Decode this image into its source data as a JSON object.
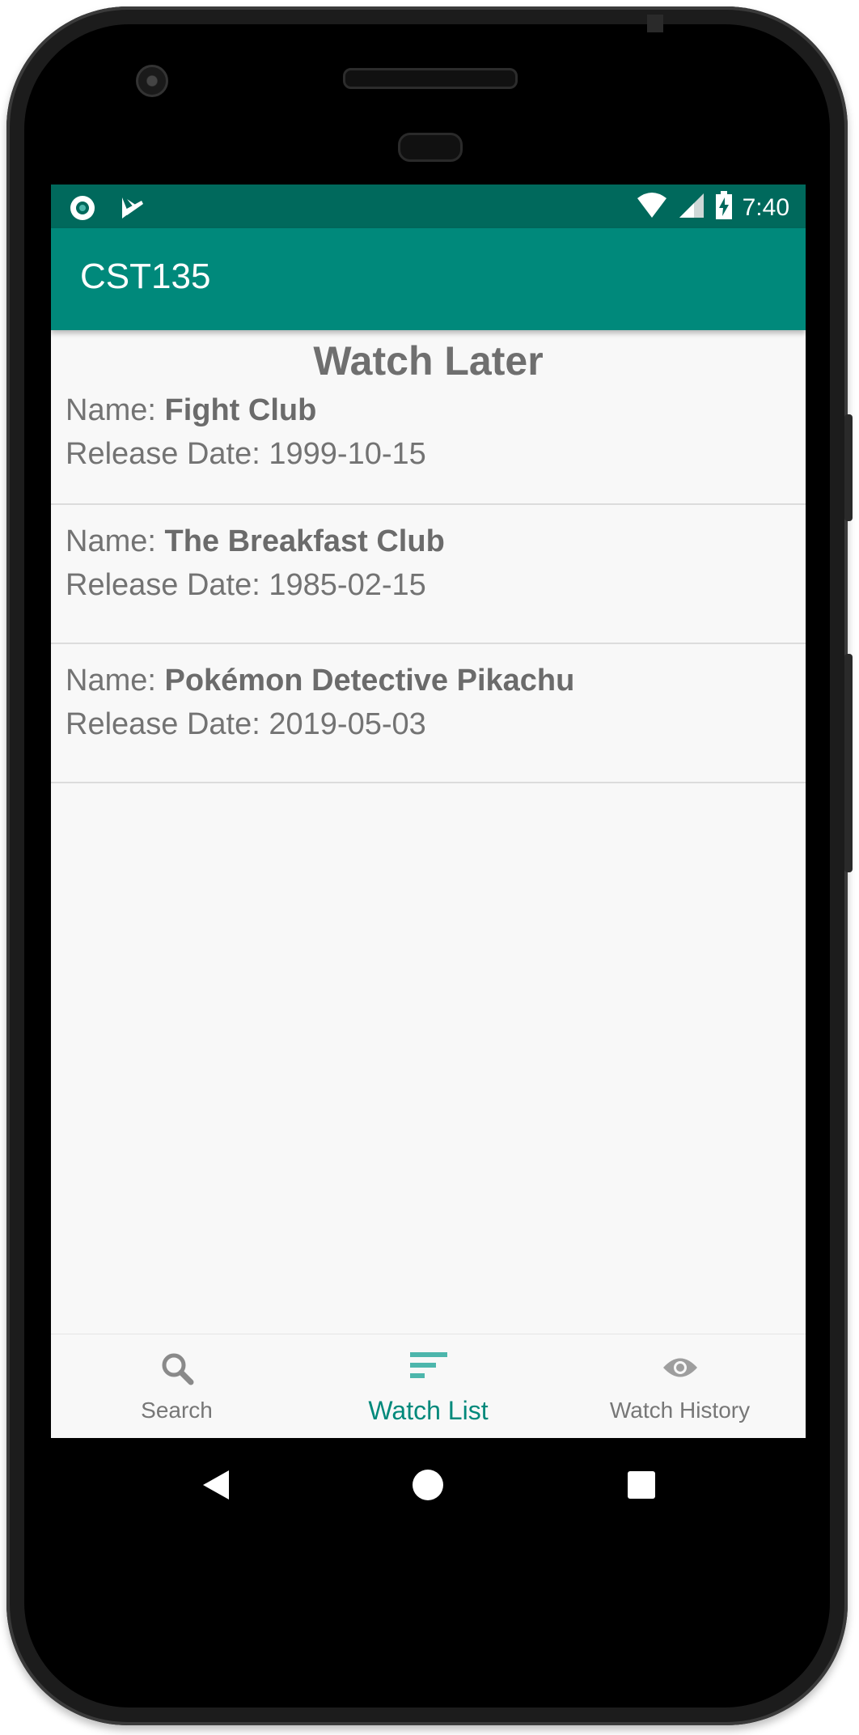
{
  "status_bar": {
    "time": "7:40",
    "left_icons": [
      "radio-record-icon",
      "play-store-notification-icon"
    ],
    "right_icons": [
      "wifi-icon",
      "cell-signal-icon",
      "battery-charging-icon"
    ]
  },
  "app_bar": {
    "title": "CST135"
  },
  "page": {
    "title": "Watch Later"
  },
  "movies": [
    {
      "name_label": "Name: ",
      "name": "Fight Club",
      "date_label": "Release Date: ",
      "date": "1999-10-15"
    },
    {
      "name_label": "Name: ",
      "name": "The Breakfast Club",
      "date_label": "Release Date: ",
      "date": "1985-02-15"
    },
    {
      "name_label": "Name: ",
      "name": "Pokémon Detective Pikachu",
      "date_label": "Release Date: ",
      "date": "2019-05-03"
    }
  ],
  "bottom_nav": {
    "items": [
      {
        "label": "Search",
        "icon": "search-icon",
        "active": false
      },
      {
        "label": "Watch List",
        "icon": "list-icon",
        "active": true
      },
      {
        "label": "Watch History",
        "icon": "eye-icon",
        "active": false
      }
    ]
  },
  "colors": {
    "status_bar": "#00695c",
    "app_bar": "#00897b",
    "accent": "#00897b",
    "text_secondary": "#737373"
  },
  "system_nav": [
    "back-icon",
    "home-icon",
    "recents-icon"
  ]
}
